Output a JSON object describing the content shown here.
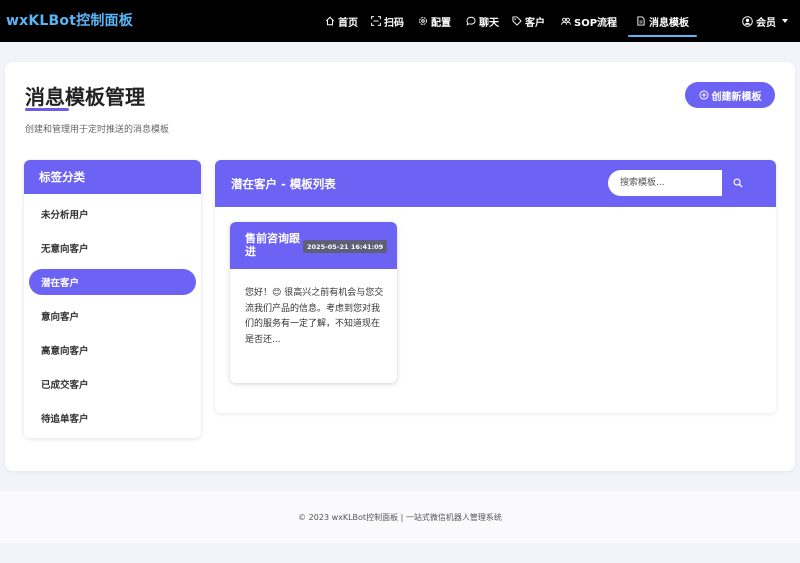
{
  "navbar": {
    "brand": "wxKLBot控制面板",
    "items": [
      {
        "label": "首页",
        "icon": "home-icon"
      },
      {
        "label": "扫码",
        "icon": "scan-icon"
      },
      {
        "label": "配置",
        "icon": "gear-icon"
      },
      {
        "label": "聊天",
        "icon": "chat-icon"
      },
      {
        "label": "客户",
        "icon": "tag-icon"
      },
      {
        "label": "SOP流程",
        "icon": "users-icon"
      },
      {
        "label": "消息模板",
        "icon": "file-icon"
      }
    ],
    "active_item": "消息模板",
    "user_label": "会员",
    "accent_color": "#5ab4f5"
  },
  "page": {
    "title": "消息模板管理",
    "subtitle": "创建和管理用于定时推送的消息模板",
    "create_button": "创建新模板",
    "primary_color": "#6c63f5"
  },
  "sidebar": {
    "header": "标签分类",
    "items": [
      "未分析用户",
      "无意向客户",
      "潜在客户",
      "意向客户",
      "高意向客户",
      "已成交客户",
      "待追单客户"
    ],
    "active_item": "潜在客户"
  },
  "panel": {
    "title": "潜在客户 - 模板列表",
    "search_placeholder": "搜索模板..."
  },
  "templates": [
    {
      "name": "售前咨询跟进",
      "date": "2025-05-21 16:41:09",
      "preview": "您好！😊 很高兴之前有机会与您交流我们产品的信息。考虑到您对我们的服务有一定了解，不知道现在是否还..."
    }
  ],
  "footer": {
    "text": "© 2023 wxKLBot控制面板 | 一站式微信机器人管理系统"
  }
}
